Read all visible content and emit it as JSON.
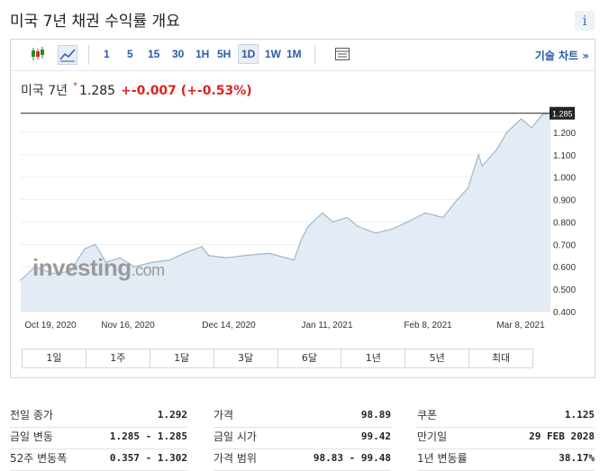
{
  "title": "미국 7년 채권 수익률 개요",
  "info_icon": "i",
  "toolbar": {
    "timeframes": [
      "1",
      "5",
      "15",
      "30",
      "1H",
      "5H",
      "1D",
      "1W",
      "1M"
    ],
    "active_timeframe": "1D",
    "tech_chart": "기술 차트 »"
  },
  "quote": {
    "name": "미국 7년",
    "star": "*",
    "price": "1.285",
    "change": "+-0.007 (+-0.53%)"
  },
  "chart_data": {
    "type": "area",
    "x_labels": [
      "Oct 19, 2020",
      "Nov 16, 2020",
      "Dec 14, 2020",
      "Jan 11, 2021",
      "Feb 8, 2021",
      "Mar 8, 2021"
    ],
    "x": [
      "2020-10-19",
      "2020-10-23",
      "2020-10-28",
      "2020-11-02",
      "2020-11-06",
      "2020-11-09",
      "2020-11-12",
      "2020-11-16",
      "2020-11-20",
      "2020-11-25",
      "2020-11-30",
      "2020-12-04",
      "2020-12-09",
      "2020-12-11",
      "2020-12-16",
      "2020-12-21",
      "2020-12-28",
      "2021-01-04",
      "2021-01-06",
      "2021-01-08",
      "2021-01-12",
      "2021-01-15",
      "2021-01-19",
      "2021-01-22",
      "2021-01-27",
      "2021-02-01",
      "2021-02-05",
      "2021-02-10",
      "2021-02-15",
      "2021-02-19",
      "2021-02-22",
      "2021-02-25",
      "2021-02-26",
      "2021-03-02",
      "2021-03-05",
      "2021-03-09",
      "2021-03-12",
      "2021-03-15",
      "2021-03-17"
    ],
    "values": [
      0.54,
      0.6,
      0.57,
      0.58,
      0.68,
      0.7,
      0.62,
      0.64,
      0.6,
      0.62,
      0.63,
      0.66,
      0.69,
      0.65,
      0.64,
      0.65,
      0.66,
      0.63,
      0.72,
      0.78,
      0.84,
      0.8,
      0.82,
      0.78,
      0.75,
      0.77,
      0.8,
      0.84,
      0.82,
      0.9,
      0.95,
      1.1,
      1.05,
      1.12,
      1.2,
      1.26,
      1.22,
      1.28,
      1.285
    ],
    "y_ticks": [
      0.4,
      0.5,
      0.6,
      0.7,
      0.8,
      0.9,
      1.0,
      1.1,
      1.2
    ],
    "y_tick_labels": [
      "0.400",
      "0.500",
      "0.600",
      "0.700",
      "0.800",
      "0.900",
      "1.000",
      "1.100",
      "1.200"
    ],
    "ylim": [
      0.4,
      1.3
    ],
    "last_value_label": "1.285",
    "watermark": "investing.com",
    "line_color": "#9fb7cf",
    "fill_color": "#e3ecf5"
  },
  "range_buttons": [
    "1일",
    "1주",
    "1달",
    "3달",
    "6달",
    "1년",
    "5년",
    "최대"
  ],
  "stats": {
    "col1": [
      {
        "label": "전일 종가",
        "value": "1.292"
      },
      {
        "label": "금일 변동",
        "value": "1.285 - 1.285"
      },
      {
        "label": "52주 변동폭",
        "value": "0.357 - 1.302"
      }
    ],
    "col2": [
      {
        "label": "가격",
        "value": "98.89"
      },
      {
        "label": "금일 시가",
        "value": "99.42"
      },
      {
        "label": "가격 범위",
        "value": "98.83 - 99.48"
      }
    ],
    "col3": [
      {
        "label": "쿠폰",
        "value": "1.125"
      },
      {
        "label": "만기일",
        "value": "29 FEB 2028"
      },
      {
        "label": "1년 변동률",
        "value": "38.17%"
      }
    ]
  }
}
